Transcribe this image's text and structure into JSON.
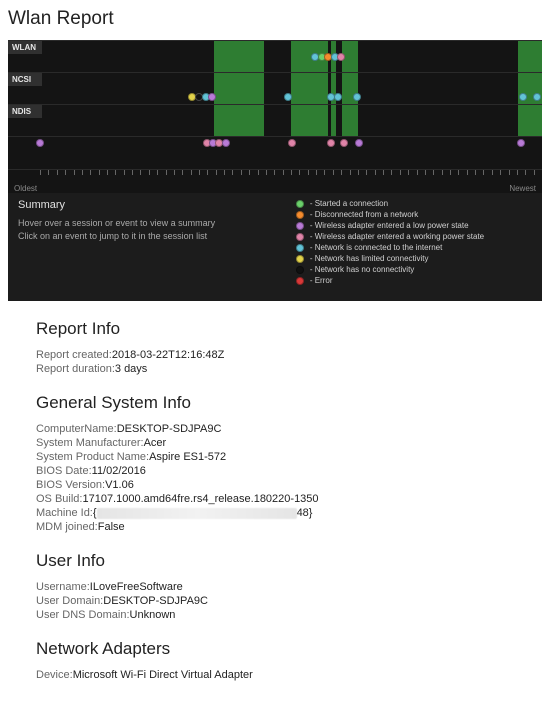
{
  "title": "Wlan Report",
  "chart_data": {
    "type": "timeline",
    "lanes": [
      "WLAN",
      "NCSI",
      "NDIS"
    ],
    "axis": {
      "left_label": "Oldest",
      "right_label": "Newest"
    },
    "bands": [
      {
        "lane": 0,
        "left_pct": 38.5,
        "width_pct": 9.5
      },
      {
        "lane": 0,
        "left_pct": 53,
        "width_pct": 7
      },
      {
        "lane": 0,
        "left_pct": 60.5,
        "width_pct": 1
      },
      {
        "lane": 0,
        "left_pct": 62.5,
        "width_pct": 3
      },
      {
        "lane": 0,
        "left_pct": 95.5,
        "width_pct": 4.5
      },
      {
        "lane": 1,
        "left_pct": 38.5,
        "width_pct": 9.5
      },
      {
        "lane": 1,
        "left_pct": 53,
        "width_pct": 7
      },
      {
        "lane": 1,
        "left_pct": 60.5,
        "width_pct": 1
      },
      {
        "lane": 1,
        "left_pct": 62.5,
        "width_pct": 3
      },
      {
        "lane": 1,
        "left_pct": 95.5,
        "width_pct": 4.5
      },
      {
        "lane": 2,
        "left_pct": 38.5,
        "width_pct": 9.5
      },
      {
        "lane": 2,
        "left_pct": 53,
        "width_pct": 7
      },
      {
        "lane": 2,
        "left_pct": 60.5,
        "width_pct": 1
      },
      {
        "lane": 2,
        "left_pct": 62.5,
        "width_pct": 3
      },
      {
        "lane": 2,
        "left_pct": 95.5,
        "width_pct": 4.5
      }
    ],
    "event_strips": [
      {
        "lane": 0,
        "y_pct": 40,
        "dots": [
          {
            "x_pct": 57.5,
            "color": "cyan"
          },
          {
            "x_pct": 58.8,
            "color": "green"
          },
          {
            "x_pct": 60,
            "color": "orange"
          },
          {
            "x_pct": 61.2,
            "color": "cyan"
          },
          {
            "x_pct": 62.4,
            "color": "pinkish"
          }
        ]
      },
      {
        "lane": 1,
        "y_pct": 65,
        "dots": [
          {
            "x_pct": 34.5,
            "color": "yellow"
          },
          {
            "x_pct": 35.8,
            "color": "black"
          },
          {
            "x_pct": 37,
            "color": "cyan"
          },
          {
            "x_pct": 38.2,
            "color": "purple"
          },
          {
            "x_pct": 52.5,
            "color": "cyan"
          },
          {
            "x_pct": 60.5,
            "color": "cyan"
          },
          {
            "x_pct": 61.8,
            "color": "cyan"
          },
          {
            "x_pct": 65.3,
            "color": "cyan"
          },
          {
            "x_pct": 96.5,
            "color": "cyan"
          },
          {
            "x_pct": 99,
            "color": "cyan"
          }
        ]
      },
      {
        "lane": 3,
        "y_pct": 10,
        "dots": [
          {
            "x_pct": 6,
            "color": "purple"
          },
          {
            "x_pct": 37.2,
            "color": "pinkish"
          },
          {
            "x_pct": 38.4,
            "color": "purple"
          },
          {
            "x_pct": 39.6,
            "color": "pinkish"
          },
          {
            "x_pct": 40.8,
            "color": "purple"
          },
          {
            "x_pct": 53.2,
            "color": "pinkish"
          },
          {
            "x_pct": 60.5,
            "color": "pinkish"
          },
          {
            "x_pct": 63,
            "color": "pinkish"
          },
          {
            "x_pct": 65.8,
            "color": "purple"
          },
          {
            "x_pct": 96,
            "color": "purple"
          }
        ]
      }
    ]
  },
  "summary": {
    "heading": "Summary",
    "line1": "Hover over a session or event to view a summary",
    "line2": "Click on an event to jump to it in the session list"
  },
  "legend": [
    {
      "color": "green",
      "text": "- Started a connection"
    },
    {
      "color": "orange",
      "text": "- Disconnected from a network"
    },
    {
      "color": "purple",
      "text": "- Wireless adapter entered a low power state"
    },
    {
      "color": "pinkish",
      "text": "- Wireless adapter entered a working power state"
    },
    {
      "color": "cyan",
      "text": "- Network is connected to the internet"
    },
    {
      "color": "yellow",
      "text": "- Network has limited connectivity"
    },
    {
      "color": "black",
      "text": "- Network has no connectivity"
    },
    {
      "color": "red",
      "text": "- Error"
    }
  ],
  "sections": {
    "report_info": {
      "heading": "Report Info",
      "rows": [
        {
          "label": "Report created:",
          "value": "2018-03-22T12:16:48Z"
        },
        {
          "label": "Report duration:",
          "value": "3 days"
        }
      ]
    },
    "general": {
      "heading": "General System Info",
      "rows": [
        {
          "label": "ComputerName:",
          "value": "DESKTOP-SDJPA9C"
        },
        {
          "label": "System Manufacturer:",
          "value": "Acer"
        },
        {
          "label": "System Product Name:",
          "value": "Aspire ES1-572"
        },
        {
          "label": "BIOS Date:",
          "value": "11/02/2016"
        },
        {
          "label": "BIOS Version:",
          "value": "V1.06"
        },
        {
          "label": "OS Build:",
          "value": "17107.1000.amd64fre.rs4_release.180220-1350"
        },
        {
          "label": "Machine Id:",
          "value": "{",
          "redacted": true,
          "tail": "48}"
        },
        {
          "label": "MDM joined:",
          "value": "False"
        }
      ]
    },
    "user": {
      "heading": "User Info",
      "rows": [
        {
          "label": "Username:",
          "value": "ILoveFreeSoftware"
        },
        {
          "label": "User Domain:",
          "value": "DESKTOP-SDJPA9C"
        },
        {
          "label": "User DNS Domain:",
          "value": "Unknown"
        }
      ]
    },
    "adapters": {
      "heading": "Network Adapters",
      "rows": [
        {
          "label": "Device:",
          "value": "Microsoft Wi-Fi Direct Virtual Adapter"
        }
      ]
    }
  }
}
